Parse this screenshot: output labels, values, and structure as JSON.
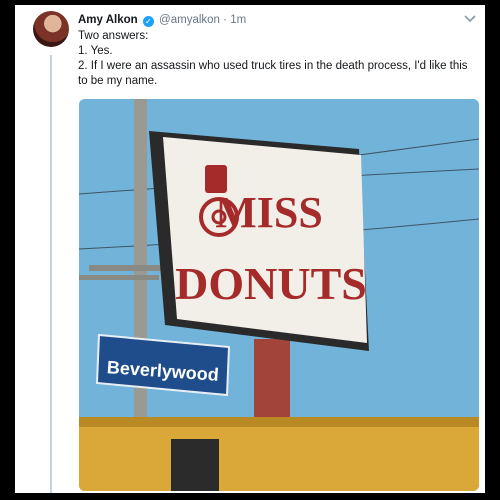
{
  "tweet": {
    "author_name": "Amy Alkon",
    "verified_icon": "verified-badge-icon",
    "handle": "@amyalkon",
    "separator": "·",
    "timestamp": "1m",
    "more_icon": "chevron-down-icon",
    "lines": [
      "Two answers:",
      "1. Yes.",
      "2. If I were an assassin who used truck tires in the death process, I'd like this to be my name."
    ]
  },
  "photo": {
    "sign_line1": "MISS",
    "sign_line2": "DONUTS",
    "street_sign": "Beverlywood",
    "colors": {
      "sky": "#6fb0d6",
      "sign_text": "#a52a2a",
      "street_sign": "#1f4d8c"
    }
  }
}
